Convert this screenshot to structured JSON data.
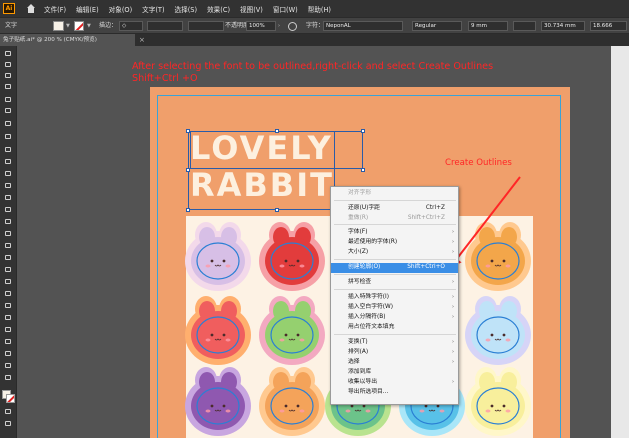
{
  "app": {
    "logo": "Ai"
  },
  "menu": [
    "文件(F)",
    "编辑(E)",
    "对象(O)",
    "文字(T)",
    "选择(S)",
    "效果(C)",
    "视图(V)",
    "窗口(W)",
    "帮助(H)"
  ],
  "control_bar": {
    "object_type": "文字",
    "stroke_label": "描边：",
    "stroke_value": "◇",
    "opacity_label": "不透明度",
    "opacity_value": "100%",
    "character_label": "字符：",
    "font_family": "NeponAL",
    "font_style": "Regular",
    "font_size": "9 mm",
    "tracking": "30.734 mm",
    "leading": "18.666"
  },
  "document_tab": {
    "title": "兔子贴纸.ai* @ 200 % (CMYK/预览)",
    "close": "×"
  },
  "artwork": {
    "title_line1": "LOVELY",
    "title_line2": "RABBIT",
    "background_color": "#f09f6b",
    "panel_color": "#fdf2e4"
  },
  "annotations": {
    "instruction_line1": "After selecting the font to be outlined,right-click and select Create Outlines",
    "instruction_line2": "Shift+Ctrl +O",
    "callout": "Create Outlines",
    "color": "#ff2626"
  },
  "bunnies": [
    {
      "fill": "#d7bfe6",
      "outline": "#f3d9ea"
    },
    {
      "fill": "#e23c3c",
      "outline": "#f6a0a6"
    },
    {
      "fill": "#f3a64a",
      "outline": "#ffc98f"
    },
    {
      "fill": "#f05e5e",
      "outline": "#ffaf6e"
    },
    {
      "fill": "#95d06f",
      "outline": "#f3a9c1"
    },
    {
      "fill": "#bfe3f8",
      "outline": "#d6d4f7"
    },
    {
      "fill": "#8f58b0",
      "outline": "#c8a6e0"
    },
    {
      "fill": "#f4a35a",
      "outline": "#ffc990"
    },
    {
      "fill": "#6cc38a",
      "outline": "#b9e38f"
    },
    {
      "fill": "#58c1e8",
      "outline": "#a9e6f8"
    },
    {
      "fill": "#f8ef9c",
      "outline": "#fff7c9"
    }
  ],
  "context_menu": {
    "header": "对齐字形",
    "items": [
      {
        "label": "还原(U)字距",
        "shortcut": "Ctrl+Z",
        "arrow": "",
        "state": "normal"
      },
      {
        "label": "重做(R)",
        "shortcut": "Shift+Ctrl+Z",
        "arrow": "",
        "state": "disabled"
      },
      {
        "label": "字体(F)",
        "shortcut": "",
        "arrow": "›",
        "state": "normal"
      },
      {
        "label": "最近使用的字体(R)",
        "shortcut": "",
        "arrow": "›",
        "state": "normal"
      },
      {
        "label": "大小(Z)",
        "shortcut": "",
        "arrow": "›",
        "state": "normal"
      },
      {
        "label": "创建轮廓(O)",
        "shortcut": "Shift+Ctrl+O",
        "arrow": "",
        "state": "highlighted"
      },
      {
        "label": "拼写检查",
        "shortcut": "",
        "arrow": "›",
        "state": "normal"
      },
      {
        "label": "插入特殊字符(I)",
        "shortcut": "",
        "arrow": "›",
        "state": "normal"
      },
      {
        "label": "插入空白字符(W)",
        "shortcut": "",
        "arrow": "›",
        "state": "normal"
      },
      {
        "label": "插入分隔符(B)",
        "shortcut": "",
        "arrow": "›",
        "state": "normal"
      },
      {
        "label": "用占位符文本填充",
        "shortcut": "",
        "arrow": "",
        "state": "normal"
      },
      {
        "label": "变换(T)",
        "shortcut": "",
        "arrow": "›",
        "state": "normal"
      },
      {
        "label": "排列(A)",
        "shortcut": "",
        "arrow": "›",
        "state": "normal"
      },
      {
        "label": "选择",
        "shortcut": "",
        "arrow": "›",
        "state": "normal"
      },
      {
        "label": "添加到库",
        "shortcut": "",
        "arrow": "",
        "state": "normal"
      },
      {
        "label": "收集以导出",
        "shortcut": "",
        "arrow": "›",
        "state": "normal"
      },
      {
        "label": "导出所选项目...",
        "shortcut": "",
        "arrow": "",
        "state": "normal"
      }
    ]
  }
}
